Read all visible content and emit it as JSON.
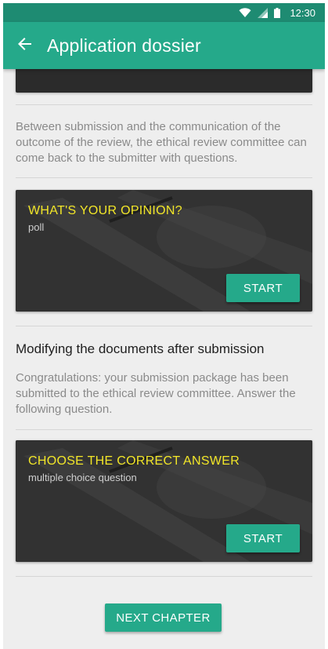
{
  "status_bar": {
    "time": "12:30",
    "icons": [
      "wifi-icon",
      "cellular-signal-icon",
      "battery-icon"
    ]
  },
  "app_bar": {
    "back_icon": "arrow-back-icon",
    "title": "Application dossier"
  },
  "colors": {
    "primary": "#25a98a",
    "primary_dark": "#1e8b72",
    "card_title": "#f2e628",
    "background": "#eeeeee"
  },
  "content": {
    "intro_paragraph": "Between submission and the communication of the outcome of the review, the ethical review committee can come back to the submitter with questions.",
    "poll_card": {
      "title": "WHAT'S YOUR OPINION?",
      "subtitle": "poll",
      "button_label": "START"
    },
    "section": {
      "heading": "Modifying the documents after submission",
      "paragraph": "Congratulations: your submission package has been submitted to the ethical review committee. Answer the following question."
    },
    "quiz_card": {
      "title": "CHOOSE THE CORRECT ANSWER",
      "subtitle": "multiple choice question",
      "button_label": "START"
    },
    "next_chapter_label": "NEXT CHAPTER"
  }
}
